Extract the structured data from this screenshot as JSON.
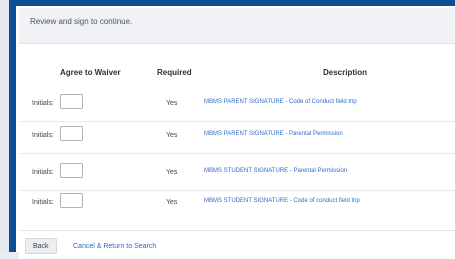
{
  "instruction": "Review and sign to continue.",
  "table": {
    "headers": {
      "agree": "Agree to Waiver",
      "required": "Required",
      "description": "Description"
    },
    "rows": [
      {
        "initials_label": "Initials:",
        "required": "Yes",
        "description": "MBMS PARENT SIGNATURE - Code of Conduct field trip"
      },
      {
        "initials_label": "Initials:",
        "required": "Yes",
        "description": "MBMS PARENT SIGNATURE - Parental Permission"
      },
      {
        "initials_label": "Initials:",
        "required": "Yes",
        "description": "MBMS STUDENT SIGNATURE - Parental Permission"
      },
      {
        "initials_label": "Initials:",
        "required": "Yes",
        "description": "MBMS STUDENT SIGNATURE - Code of conduct field trip"
      }
    ]
  },
  "footer": {
    "back_label": "Back",
    "cancel_label": "Cancel & Return to Search"
  },
  "colors": {
    "frame_border": "#0d4d92",
    "link": "#2f6dc8"
  }
}
